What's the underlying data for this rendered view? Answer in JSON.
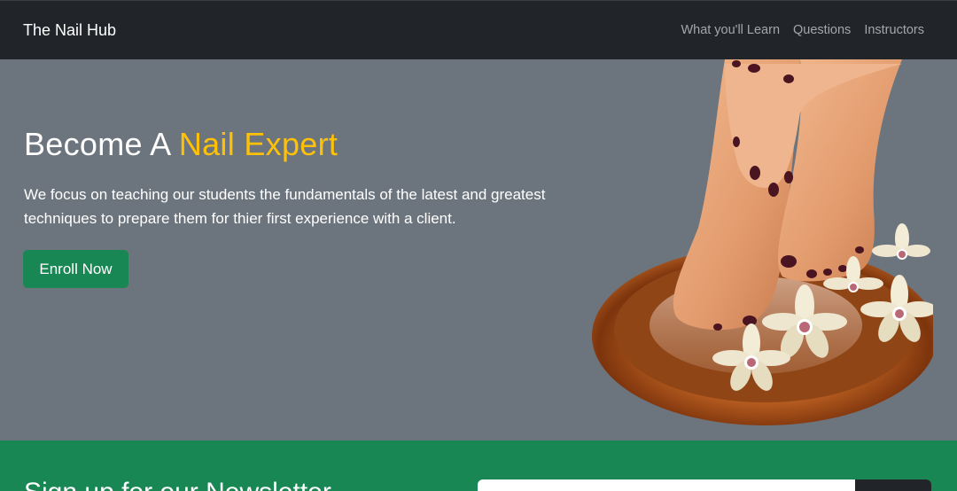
{
  "navbar": {
    "brand": "The Nail Hub",
    "links": [
      "What you'll Learn",
      "Questions",
      "Instructors"
    ]
  },
  "hero": {
    "title_prefix": "Become A ",
    "title_accent": "Nail Expert",
    "description": "We focus on teaching our students the fundamentals of the latest and greatest techniques to prepare them for thier first experience with a client.",
    "button_label": "Enroll Now",
    "image_icon": "feet-with-orchids-in-bowl-image"
  },
  "newsletter": {
    "title": "Sign up for our Newsletter"
  },
  "colors": {
    "navbar": "#212529",
    "hero_bg": "#6c757d",
    "accent": "#ffc107",
    "primary_green": "#198754"
  }
}
